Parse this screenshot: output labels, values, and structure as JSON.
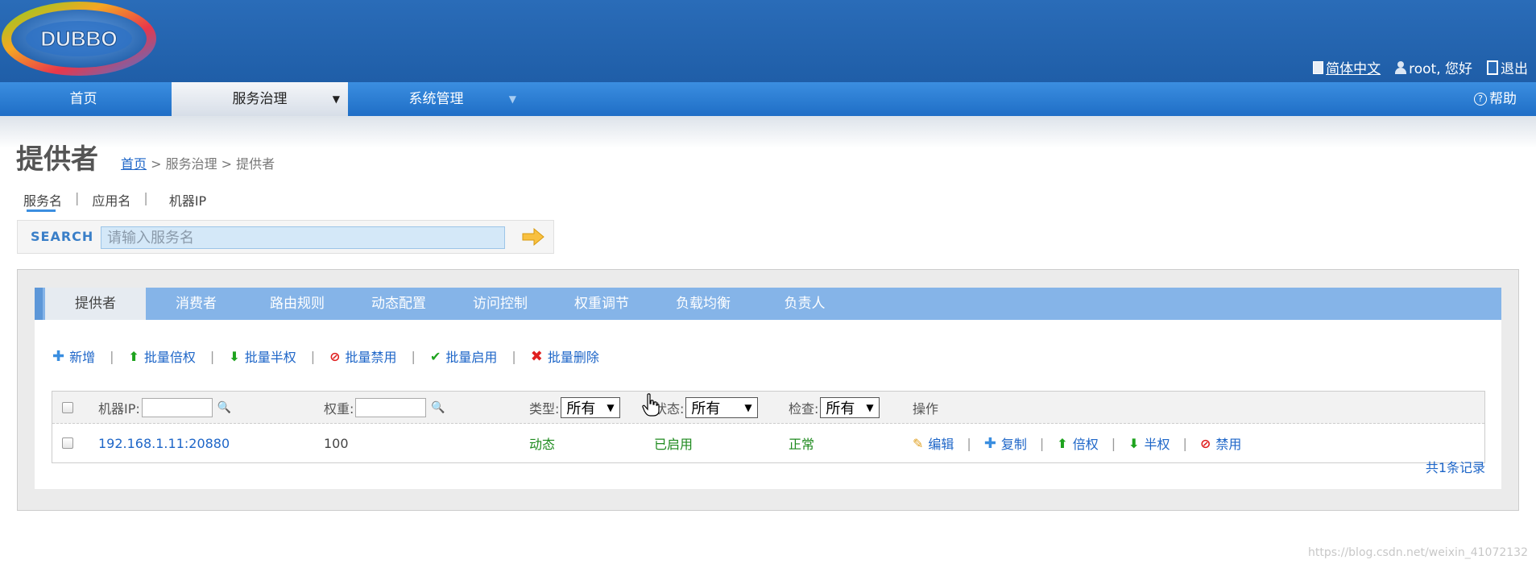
{
  "header": {
    "logo_text": "DUBBO",
    "language": "简体中文",
    "user": "root, 您好",
    "logout": "退出"
  },
  "nav": {
    "items": [
      {
        "label": "首页"
      },
      {
        "label": "服务治理"
      },
      {
        "label": "系统管理"
      }
    ],
    "help": "帮助"
  },
  "page": {
    "title": "提供者",
    "breadcrumb": {
      "home": "首页",
      "rest": " > 服务治理 > 提供者"
    }
  },
  "search": {
    "tabs": [
      "服务名",
      "应用名",
      "机器IP"
    ],
    "label": "SEARCH",
    "placeholder": "请输入服务名"
  },
  "tabs": [
    "提供者",
    "消费者",
    "路由规则",
    "动态配置",
    "访问控制",
    "权重调节",
    "负载均衡",
    "负责人"
  ],
  "actions": {
    "add": "新增",
    "double": "批量倍权",
    "half": "批量半权",
    "disable": "批量禁用",
    "enable": "批量启用",
    "delete": "批量删除"
  },
  "table": {
    "headers": {
      "ip": "机器IP:",
      "weight": "权重:",
      "type": "类型:",
      "status": "状态:",
      "check": "检查:",
      "ops": "操作"
    },
    "filters": {
      "type": "所有",
      "status": "所有",
      "check": "所有"
    },
    "rows": [
      {
        "ip": "192.168.1.11:20880",
        "weight": "100",
        "type": "动态",
        "status": "已启用",
        "check": "正常",
        "ops": {
          "edit": "编辑",
          "copy": "复制",
          "double": "倍权",
          "half": "半权",
          "disable": "禁用"
        }
      }
    ]
  },
  "records": "共1条记录",
  "watermark": "https://blog.csdn.net/weixin_41072132",
  "colors": {
    "header": "#1f5ea8",
    "nav": "#2f80d8",
    "link": "#1e66c8",
    "green": "#1e8a1e"
  }
}
